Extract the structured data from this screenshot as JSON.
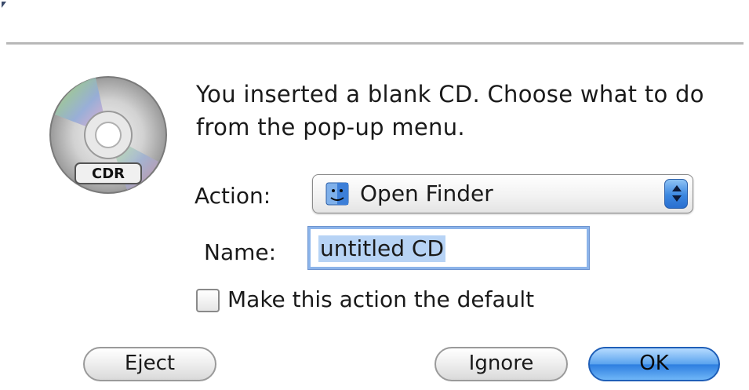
{
  "dialog": {
    "message": "You inserted a blank CD. Choose what to do from the pop-up menu.",
    "icon_label": "CDR"
  },
  "action": {
    "label": "Action:",
    "selected": "Open Finder",
    "icon": "finder-icon"
  },
  "name": {
    "label": "Name:",
    "value": "untitled CD"
  },
  "default_checkbox": {
    "label": "Make this action the default",
    "checked": false
  },
  "buttons": {
    "eject": "Eject",
    "ignore": "Ignore",
    "ok": "OK"
  },
  "colors": {
    "accent": "#3b87e0",
    "selection": "#b7d3f5",
    "focus_ring": "#8cb4ea"
  }
}
